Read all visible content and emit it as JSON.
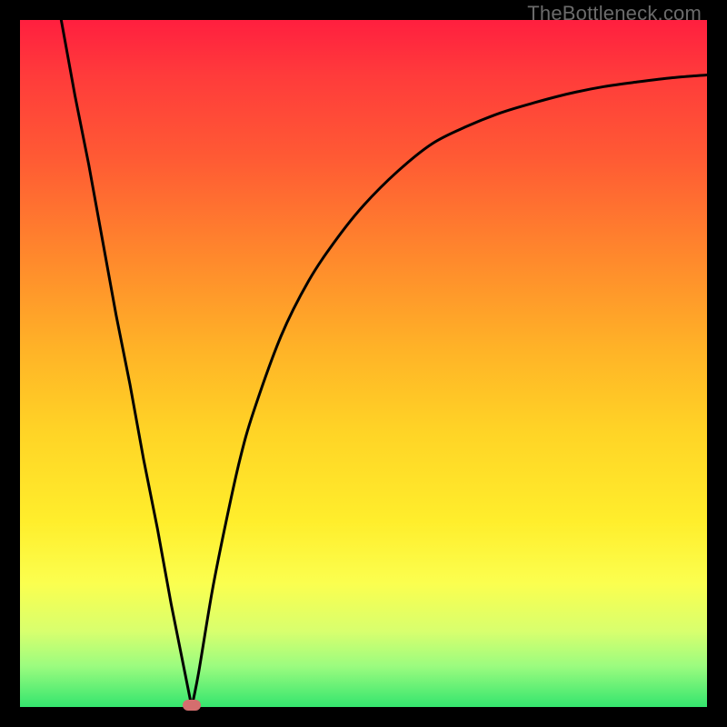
{
  "watermark": "TheBottleneck.com",
  "chart_data": {
    "type": "line",
    "title": "",
    "xlabel": "",
    "ylabel": "",
    "xlim": [
      0,
      100
    ],
    "ylim": [
      0,
      100
    ],
    "grid": false,
    "legend": false,
    "series": [
      {
        "name": "bottleneck-curve",
        "x": [
          6,
          8,
          10,
          12,
          14,
          16,
          18,
          20,
          22,
          24,
          25,
          26,
          28,
          30,
          32,
          34,
          38,
          42,
          46,
          50,
          55,
          60,
          65,
          70,
          75,
          80,
          85,
          90,
          95,
          100
        ],
        "y": [
          100,
          89,
          79,
          68,
          57,
          47,
          36,
          26,
          15,
          5,
          0,
          5,
          17,
          27,
          36,
          43,
          54,
          62,
          68,
          73,
          78,
          82,
          84.5,
          86.5,
          88,
          89.3,
          90.3,
          91,
          91.6,
          92
        ]
      }
    ],
    "annotations": [
      {
        "name": "min-point",
        "x": 25,
        "y": 0
      }
    ],
    "background_gradient": {
      "direction": "vertical",
      "stops": [
        {
          "pos": 0,
          "color": "#ff1f3f"
        },
        {
          "pos": 20,
          "color": "#ff5a34"
        },
        {
          "pos": 48,
          "color": "#ffb327"
        },
        {
          "pos": 73,
          "color": "#ffee2c"
        },
        {
          "pos": 89,
          "color": "#d8ff6e"
        },
        {
          "pos": 100,
          "color": "#34e56e"
        }
      ]
    }
  }
}
